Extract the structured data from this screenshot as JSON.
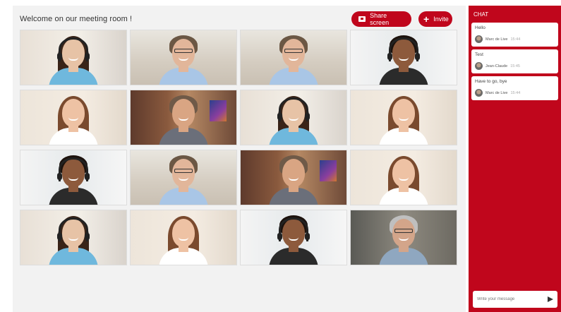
{
  "header": {
    "title": "Welcome on our meeting room !"
  },
  "toolbar": {
    "share_label": "Share screen",
    "invite_label": "Invite",
    "accent": "#c0061c"
  },
  "participants": [
    {
      "bg": "a",
      "skin": "#e7c3a6",
      "hair": "#3a2418",
      "shirt": "#6fb8dd",
      "style": "headset-f"
    },
    {
      "bg": "b",
      "skin": "#e2b69a",
      "hair": "#6b5744",
      "shirt": "#a9c6e6",
      "style": "glasses-m"
    },
    {
      "bg": "b",
      "skin": "#e2b69a",
      "hair": "#6b5744",
      "shirt": "#a9c6e6",
      "style": "glasses-m"
    },
    {
      "bg": "c",
      "skin": "#8d5a3c",
      "hair": "#1c120d",
      "shirt": "#2b2b2b",
      "style": "headset-m"
    },
    {
      "bg": "d",
      "skin": "#eec2a4",
      "hair": "#7a4a2e",
      "shirt": "#ffffff",
      "style": "long-f"
    },
    {
      "bg": "e",
      "skin": "#d9a583",
      "hair": "#6f5a48",
      "shirt": "#6b6f7a",
      "style": "man"
    },
    {
      "bg": "a",
      "skin": "#e7c3a6",
      "hair": "#3a2418",
      "shirt": "#6fb8dd",
      "style": "headset-f"
    },
    {
      "bg": "d",
      "skin": "#eec2a4",
      "hair": "#7a4a2e",
      "shirt": "#ffffff",
      "style": "long-f"
    },
    {
      "bg": "c",
      "skin": "#8d5a3c",
      "hair": "#1c120d",
      "shirt": "#2b2b2b",
      "style": "headset-m"
    },
    {
      "bg": "b",
      "skin": "#e2b69a",
      "hair": "#6b5744",
      "shirt": "#a9c6e6",
      "style": "glasses-m"
    },
    {
      "bg": "e",
      "skin": "#d9a583",
      "hair": "#6f5a48",
      "shirt": "#6b6f7a",
      "style": "man"
    },
    {
      "bg": "d",
      "skin": "#eec2a4",
      "hair": "#7a4a2e",
      "shirt": "#ffffff",
      "style": "long-f"
    },
    {
      "bg": "a",
      "skin": "#e7c3a6",
      "hair": "#3a2418",
      "shirt": "#6fb8dd",
      "style": "headset-f"
    },
    {
      "bg": "d",
      "skin": "#eec2a4",
      "hair": "#7a4a2e",
      "shirt": "#ffffff",
      "style": "long-f"
    },
    {
      "bg": "c",
      "skin": "#8d5a3c",
      "hair": "#1c120d",
      "shirt": "#2b2b2b",
      "style": "headset-m"
    },
    {
      "bg": "f",
      "skin": "#d3a58a",
      "hair": "#bfbfbf",
      "shirt": "#8fa7c0",
      "style": "glasses-m"
    }
  ],
  "chat": {
    "title": "CHAT",
    "messages": [
      {
        "text": "Hello",
        "author": "Marc de Live",
        "time": "15:44"
      },
      {
        "text": "Test",
        "author": "Jean-Claude",
        "time": "15:45"
      },
      {
        "text": "Have to go, bye",
        "author": "Marc de Live",
        "time": "15:44"
      }
    ],
    "input_placeholder": "Write your message"
  }
}
